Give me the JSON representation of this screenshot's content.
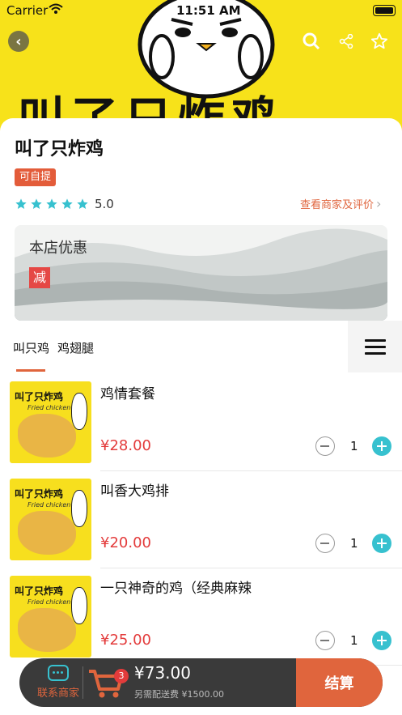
{
  "status_bar": {
    "carrier": "Carrier",
    "time": "11:51 AM"
  },
  "header": {
    "banner_text": "叫了只炸鸡",
    "icons": [
      "back-icon",
      "search-icon",
      "share-icon",
      "star-icon"
    ]
  },
  "shop": {
    "name": "叫了只炸鸡",
    "pickup_badge": "可自提",
    "rating": "5.0",
    "review_link": "查看商家及评价"
  },
  "promo": {
    "title": "本店优惠",
    "tag": "减"
  },
  "categories": {
    "tabs": [
      "叫只鸡",
      "鸡翅腿"
    ]
  },
  "products": [
    {
      "image_text": "叫了只炸鸡",
      "image_sub": "Fried chicken",
      "name": "鸡情套餐",
      "price": "¥28.00",
      "qty": "1"
    },
    {
      "image_text": "叫了只炸鸡",
      "image_sub": "Fried chicken",
      "name": "叫香大鸡排",
      "price": "¥20.00",
      "qty": "1"
    },
    {
      "image_text": "叫了只炸鸡",
      "image_sub": "Fried chicken",
      "name": "一只神奇的鸡（经典麻辣",
      "price": "¥25.00",
      "qty": "1"
    }
  ],
  "cart": {
    "contact_label": "联系商家",
    "count": "3",
    "total": "¥73.00",
    "delivery_note": "另需配送费 ¥1500.00",
    "checkout_label": "结算"
  },
  "colors": {
    "accent": "#e0653d",
    "teal": "#37c1cf",
    "price": "#e33b3b",
    "banner": "#f7e21a"
  }
}
